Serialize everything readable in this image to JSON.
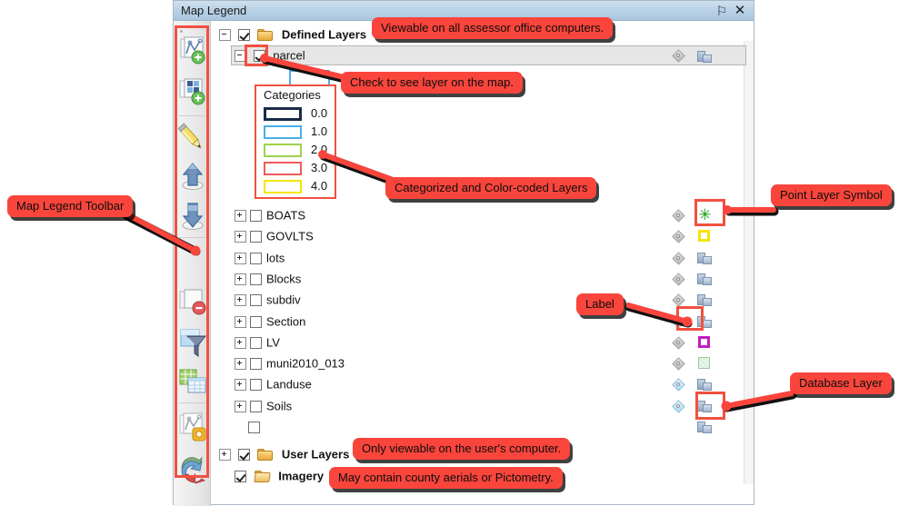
{
  "window": {
    "title": "Map Legend",
    "pin_icon": "pin-icon",
    "pin_glyph": "⚐",
    "close_icon": "close-icon",
    "close_glyph": "✕"
  },
  "toolbar": {
    "name": "Map Legend Toolbar",
    "buttons": [
      {
        "id": "add-layer",
        "name": "add-layer-button",
        "title": "Add Layer"
      },
      {
        "id": "add-group",
        "name": "add-group-button",
        "title": "Add Group"
      },
      {
        "id": "edit",
        "name": "edit-layer-button",
        "title": "Edit"
      },
      {
        "id": "move-up",
        "name": "move-layer-up-button",
        "title": "Move Up"
      },
      {
        "id": "move-down",
        "name": "move-layer-down-button",
        "title": "Move Down"
      },
      {
        "id": "remove",
        "name": "remove-layer-button",
        "title": "Remove Layer"
      },
      {
        "id": "filter",
        "name": "filter-layer-button",
        "title": "Filter"
      },
      {
        "id": "table",
        "name": "open-table-button",
        "title": "Open Table"
      },
      {
        "id": "properties",
        "name": "layer-properties-button",
        "title": "Properties"
      },
      {
        "id": "refresh",
        "name": "refresh-button",
        "title": "Refresh"
      }
    ]
  },
  "tree": {
    "root": {
      "label": "Defined Layers",
      "checked": true,
      "expanded": true,
      "folder": "closed"
    },
    "parcel": {
      "label": "parcel",
      "checked": true,
      "expanded": true,
      "selected": true
    },
    "categories": {
      "title": "Categories",
      "items": [
        {
          "value": "0.0",
          "color": "#1b2a49"
        },
        {
          "value": "1.0",
          "color": "#4aaee8"
        },
        {
          "value": "2.0",
          "color": "#9ed24e"
        },
        {
          "value": "3.0",
          "color": "#f05a5a"
        },
        {
          "value": "4.0",
          "color": "#f5e400"
        }
      ]
    },
    "layers": [
      {
        "label": "BOATS",
        "checked": false,
        "expandable": true,
        "tag": "gray",
        "symbol": "star-green"
      },
      {
        "label": "GOVLTS",
        "checked": false,
        "expandable": true,
        "tag": "gray",
        "symbol": "square-yellow"
      },
      {
        "label": "lots",
        "checked": false,
        "expandable": true,
        "tag": "gray",
        "symbol": "database"
      },
      {
        "label": "Blocks",
        "checked": false,
        "expandable": true,
        "tag": "gray",
        "symbol": "database"
      },
      {
        "label": "subdiv",
        "checked": false,
        "expandable": true,
        "tag": "gray",
        "symbol": "database"
      },
      {
        "label": "Section",
        "checked": false,
        "expandable": true,
        "tag": "blue",
        "symbol": "database"
      },
      {
        "label": "LV",
        "checked": false,
        "expandable": true,
        "tag": "gray",
        "symbol": "square-magenta"
      },
      {
        "label": "muni2010_013",
        "checked": false,
        "expandable": true,
        "tag": "gray",
        "symbol": "square-grid"
      },
      {
        "label": "Landuse",
        "checked": false,
        "expandable": true,
        "tag": "blue",
        "symbol": "database"
      },
      {
        "label": "Soils",
        "checked": false,
        "expandable": true,
        "tag": "blue",
        "symbol": "database"
      },
      {
        "label": "",
        "checked": false,
        "expandable": false,
        "tag": "none",
        "symbol": "database"
      }
    ],
    "user_layers": {
      "label": "User Layers",
      "checked": true,
      "expandable": true,
      "folder": "closed"
    },
    "imagery": {
      "label": "Imagery",
      "checked": true,
      "expandable": false,
      "folder": "open"
    }
  },
  "callouts": {
    "toolbar": "Map Legend Toolbar",
    "defined_layers": "Viewable on all assessor office computers.",
    "check_layer": "Check to see layer on the map.",
    "categorized": "Categorized and Color-coded Layers",
    "point_symbol": "Point Layer Symbol",
    "label": "Label",
    "database_layer": "Database Layer",
    "user_layers": "Only viewable on the user's computer.",
    "imagery": "May contain county aerials or Pictometry."
  },
  "colors": {
    "callout_fill": "#f9453c",
    "highlight_border": "#f2503f",
    "titlebar": "#b9d1e6"
  }
}
